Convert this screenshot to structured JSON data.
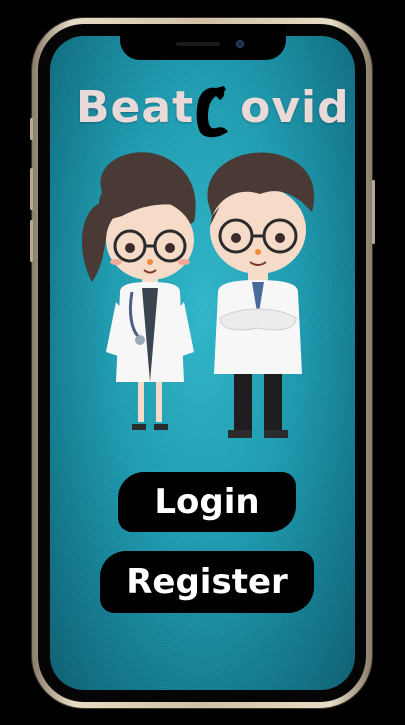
{
  "app": {
    "title_part1": "Beat",
    "title_part2": "ovid",
    "logo_icon": "flexed-arm-icon"
  },
  "illustration": {
    "characters": [
      "female-doctor-icon",
      "male-doctor-icon"
    ]
  },
  "buttons": {
    "login_label": "Login",
    "register_label": "Register"
  },
  "colors": {
    "background_teal": "#1d9bb0",
    "title_color": "#ead9d9",
    "button_bg": "#000000",
    "button_text": "#ffffff",
    "frame_gold": "#e9dcc6"
  }
}
